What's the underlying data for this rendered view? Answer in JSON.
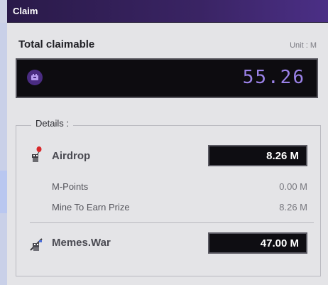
{
  "window": {
    "title": "Claim"
  },
  "total": {
    "label": "Total claimable",
    "unit": "Unit : M",
    "value": "55.26"
  },
  "details": {
    "legend": "Details :",
    "airdrop": {
      "label": "Airdrop",
      "value": "8.26  M",
      "rows": [
        {
          "label": "M-Points",
          "value": "0.00 M"
        },
        {
          "label": "Mine To Earn Prize",
          "value": "8.26 M"
        }
      ]
    },
    "memes_war": {
      "label": "Memes.War",
      "value": "47.00  M"
    }
  },
  "icons": {
    "total": "wallet-icon",
    "airdrop": "balloon-character-icon",
    "memes_war": "warrior-character-icon"
  },
  "colors": {
    "titlebar": "#3a2464",
    "digital_text": "#9b82e8",
    "wallet_icon": "#4a2c82"
  }
}
